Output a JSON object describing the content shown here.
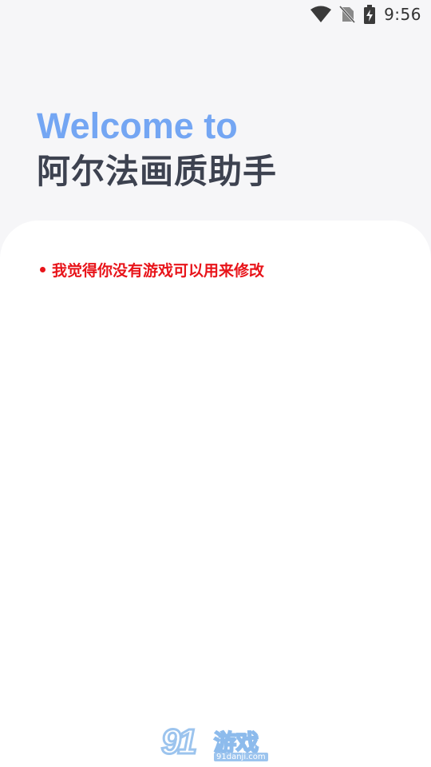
{
  "status_bar": {
    "time": "9:56",
    "icons": [
      "wifi-icon",
      "no-sim-icon",
      "battery-charging-icon"
    ]
  },
  "header": {
    "welcome": "Welcome to",
    "app_name": "阿尔法画质助手"
  },
  "card": {
    "notice": "我觉得你没有游戏可以用来修改"
  },
  "watermark": {
    "number": "91",
    "text": "游戏",
    "domain": "91danji.com"
  },
  "colors": {
    "accent": "#74a6f3",
    "title": "#3d4250",
    "notice": "#e8141a",
    "background": "#f6f6f8",
    "card": "#ffffff"
  }
}
